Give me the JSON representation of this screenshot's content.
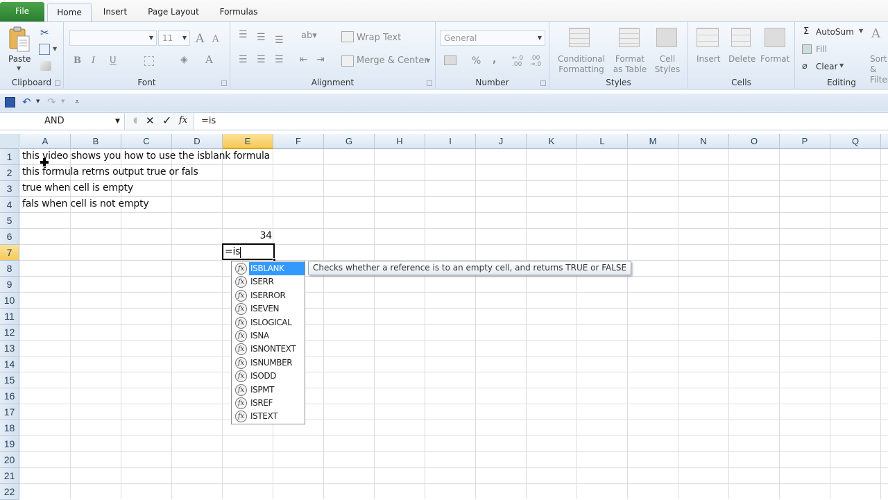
{
  "ribbon_tabs": [
    {
      "label": "File"
    },
    {
      "label": "Home",
      "active": true
    },
    {
      "label": "Insert"
    },
    {
      "label": "Page Layout"
    },
    {
      "label": "Formulas"
    }
  ],
  "clipboard": {
    "paste": "Paste",
    "group": "Clipboard"
  },
  "font": {
    "name": "",
    "size": "11",
    "group": "Font"
  },
  "alignment": {
    "wrap_text": "Wrap Text",
    "merge_center": "Merge & Center",
    "group": "Alignment"
  },
  "number": {
    "format": "General",
    "percent": "%",
    "comma": ",",
    "inc_decimal": "←.0 .00",
    "dec_decimal": ".00 →.0",
    "group": "Number"
  },
  "styles": {
    "conditional_1": "Conditional",
    "conditional_2": "Formatting",
    "format_table_1": "Format",
    "format_table_2": "as Table",
    "cell_styles_1": "Cell",
    "cell_styles_2": "Styles",
    "group": "Styles"
  },
  "cells": {
    "insert": "Insert",
    "delete": "Delete",
    "format": "Format",
    "group": "Cells"
  },
  "editing": {
    "autosum": "AutoSum",
    "fill": "Fill",
    "clear": "Clear",
    "sort_1": "Sort &",
    "sort_2": "Filter",
    "group": "Editing"
  },
  "formula_bar": {
    "name_box": "AND",
    "formula": "=is",
    "cancel": "✕",
    "enter": "✓",
    "fx": "fx"
  },
  "columns": [
    "A",
    "B",
    "C",
    "D",
    "E",
    "F",
    "G",
    "H",
    "I",
    "J",
    "K",
    "L",
    "M",
    "N",
    "O",
    "P",
    "Q"
  ],
  "selected_column": "E",
  "rows": [
    "1",
    "2",
    "3",
    "4",
    "5",
    "6",
    "7",
    "8",
    "9",
    "10",
    "11",
    "12",
    "13",
    "14",
    "15",
    "16",
    "17",
    "18",
    "19",
    "20",
    "21",
    "22"
  ],
  "selected_row": "7",
  "cells_content": {
    "A1": "this video shows you how to use the isblank formula",
    "A2": "this formula retrns output true or fals",
    "A3": "true when cell is empty",
    "A4": "fals when cell is not empty",
    "E6": "34",
    "E7": "=is"
  },
  "autocomplete": {
    "items": [
      "ISBLANK",
      "ISERR",
      "ISERROR",
      "ISEVEN",
      "ISLOGICAL",
      "ISNA",
      "ISNONTEXT",
      "ISNUMBER",
      "ISODD",
      "ISPMT",
      "ISREF",
      "ISTEXT"
    ],
    "selected": "ISBLANK",
    "tooltip": "Checks whether a reference is to an empty cell, and returns TRUE or FALSE"
  }
}
